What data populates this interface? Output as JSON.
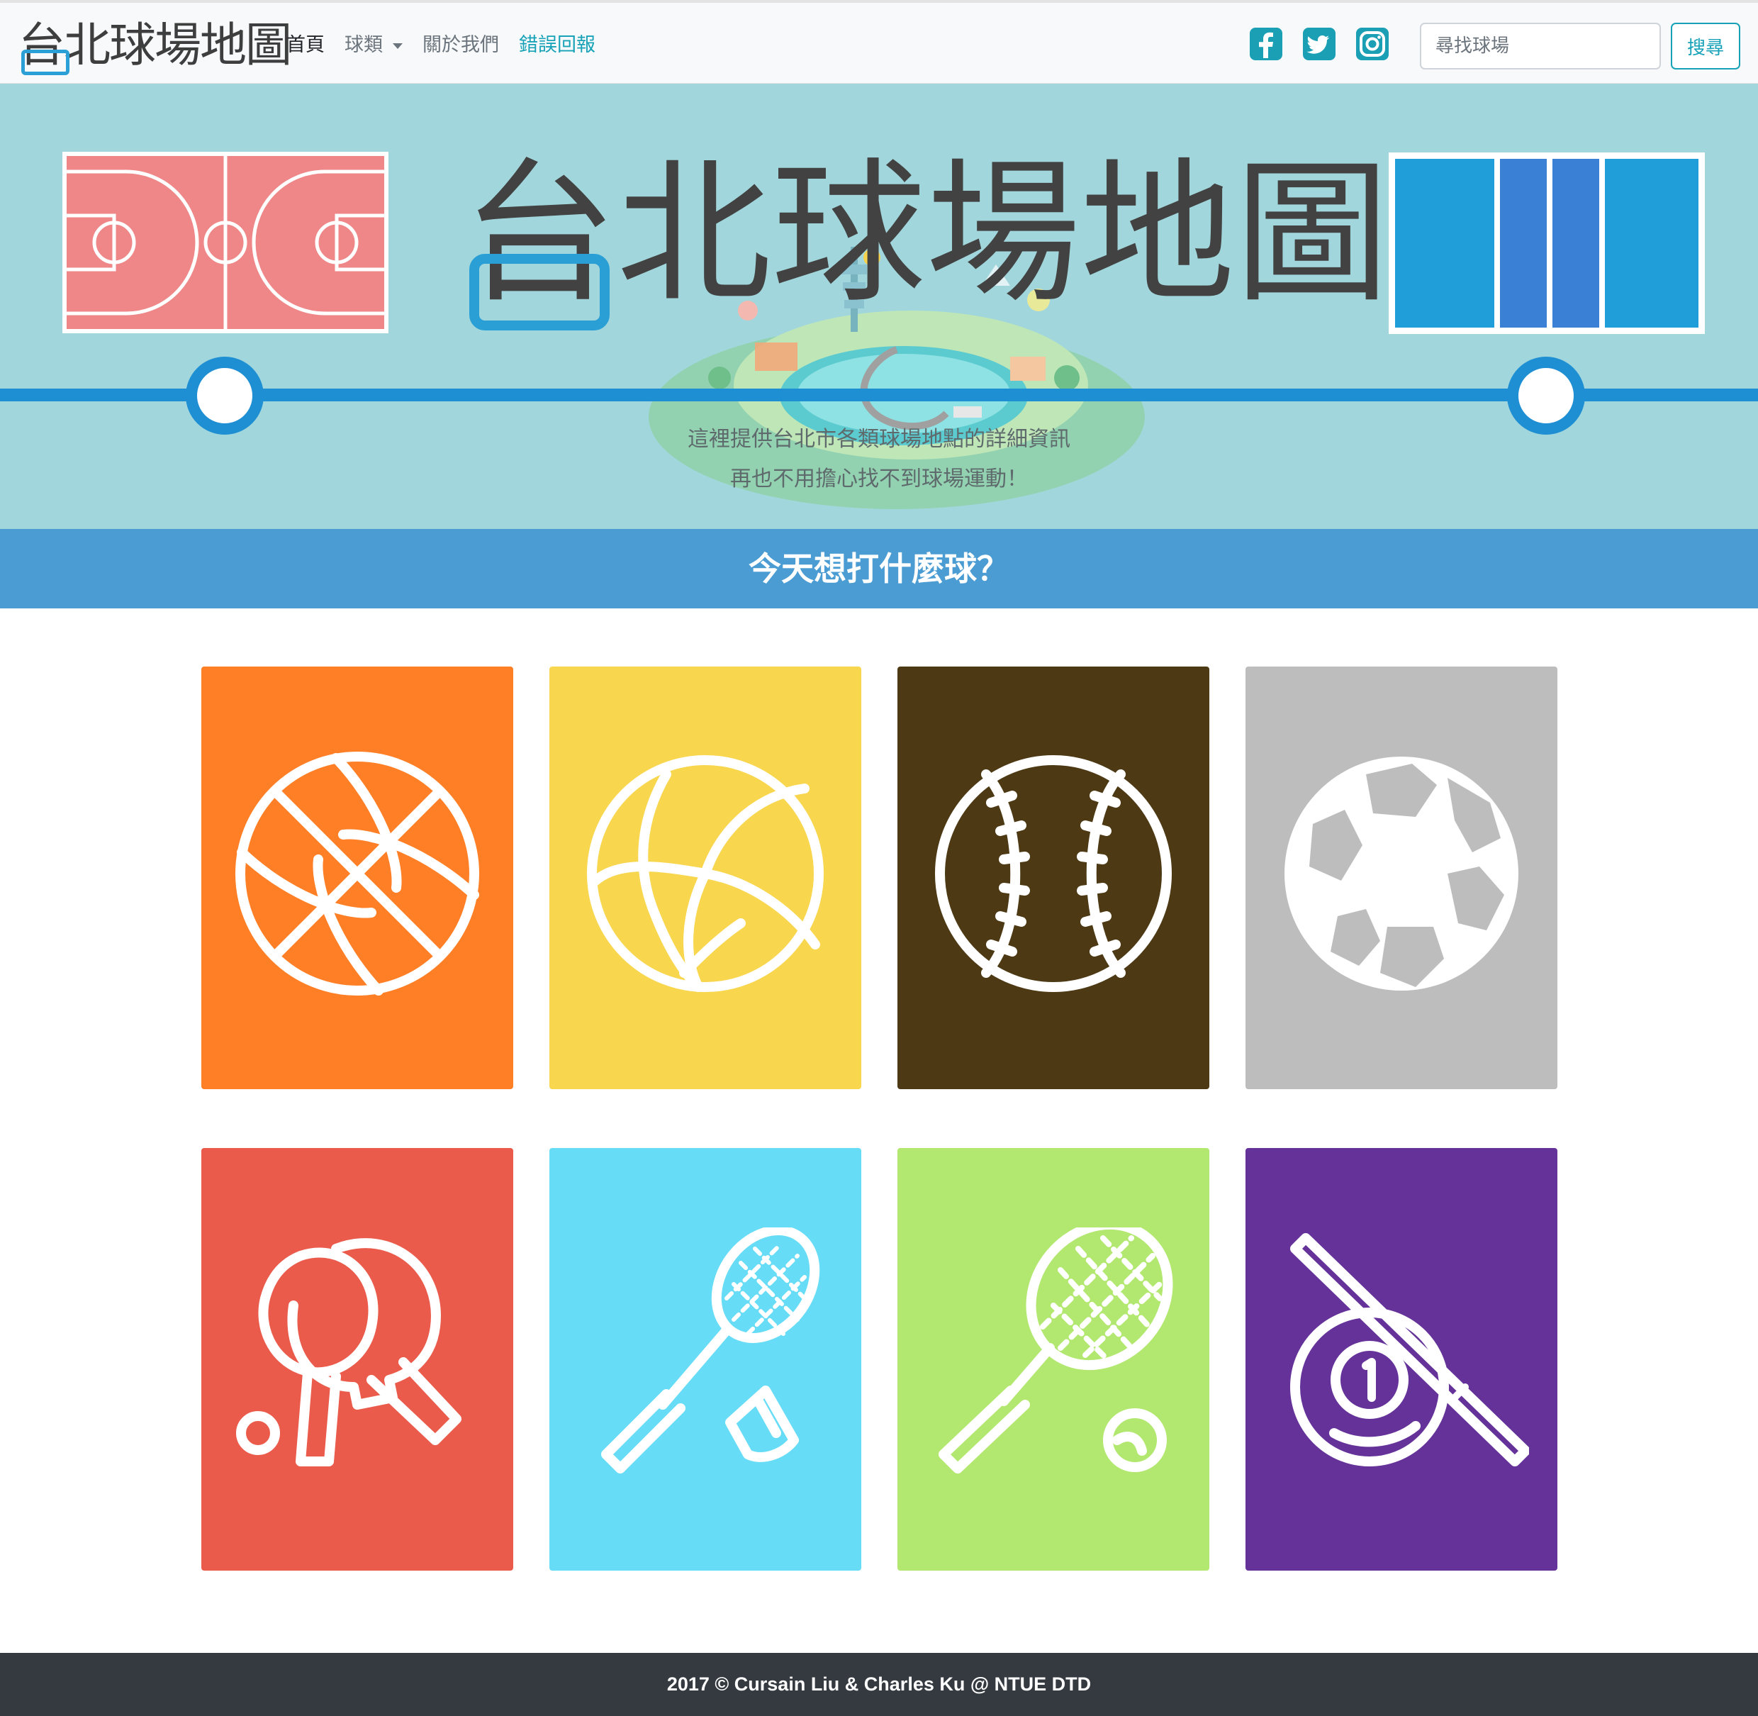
{
  "navbar": {
    "brand": "台北球場地圖",
    "links": [
      {
        "label": "首頁"
      },
      {
        "label": "球類"
      },
      {
        "label": "關於我們"
      },
      {
        "label": "錯誤回報"
      }
    ],
    "social_icons": [
      "facebook-icon",
      "twitter-icon",
      "instagram-icon"
    ],
    "search_placeholder": "尋找球場",
    "search_button": "搜尋"
  },
  "hero": {
    "title": "台北球場地圖",
    "desc_line1": "這裡提供台北市各類球場地點的詳細資訊",
    "desc_line2": "再也不用擔心找不到球場運動！"
  },
  "banner": {
    "text": "今天想打什麼球？"
  },
  "sports": [
    {
      "icon": "basketball-icon",
      "color": "#ff7f27"
    },
    {
      "icon": "volleyball-icon",
      "color": "#f8d64e"
    },
    {
      "icon": "baseball-icon",
      "color": "#4d3a15"
    },
    {
      "icon": "soccer-ball-icon",
      "color": "#bdbdbd"
    },
    {
      "icon": "table-tennis-icon",
      "color": "#eb5b4b"
    },
    {
      "icon": "badminton-icon",
      "color": "#66dcf6"
    },
    {
      "icon": "tennis-icon",
      "color": "#b3e870"
    },
    {
      "icon": "billiards-icon",
      "color": "#65329a"
    }
  ],
  "colors": {
    "hero_bg": "#a1d7dc",
    "accent_blue": "#1f8fd4",
    "banner_bg": "#4a9cd3",
    "footer_bg": "#343a40",
    "link_teal": "#17a2b8"
  },
  "footer": {
    "text": "2017 © Cursain Liu & Charles Ku @ NTUE DTD"
  }
}
